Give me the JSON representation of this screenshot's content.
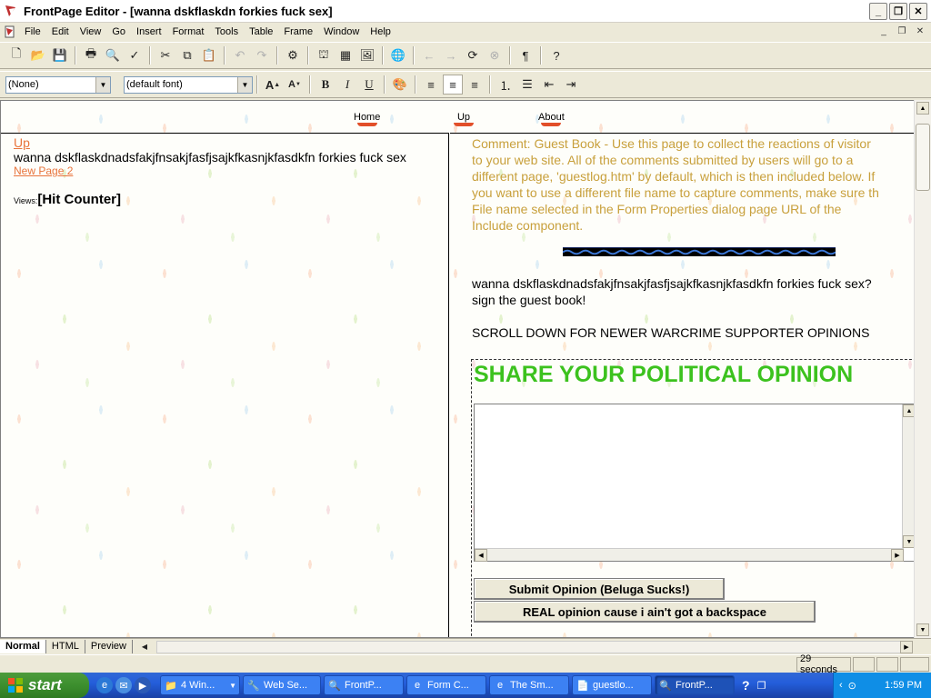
{
  "window": {
    "title": "FrontPage Editor - [wanna dskflaskdn forkies fuck sex]",
    "controls": {
      "minimize": "_",
      "maximize": "❐",
      "close": "✕"
    }
  },
  "menu": [
    "File",
    "Edit",
    "View",
    "Go",
    "Insert",
    "Format",
    "Tools",
    "Table",
    "Frame",
    "Window",
    "Help"
  ],
  "format_bar": {
    "style_value": "(None)",
    "font_value": "(default font)"
  },
  "nav": {
    "home": "Home",
    "up": "Up",
    "about": "About"
  },
  "left_frame": {
    "up_link": "Up",
    "headline": "wanna dskflaskdnadsfakjfnsakjfasfjsajkfkasnjkfasdkfn forkies fuck sex",
    "page_link": "New Page 2",
    "views_label": "Views:",
    "hit_counter": "[Hit Counter]"
  },
  "right_frame": {
    "comment_lines": [
      "Comment: Guest Book - Use this page to collect the reactions of visitor",
      "to your web site. All of the comments submitted by users will go to a",
      "different page, 'guestlog.htm' by default, which is then included below. If",
      "you want to use a different file name to capture comments, make sure th",
      "File name selected in the Form Properties dialog page URL of the",
      "Include component."
    ],
    "intro_line1": "wanna dskflaskdnadsfakjfnsakjfasfjsajkfkasnjkfasdkfn forkies fuck sex?",
    "intro_line2": "sign the guest book!",
    "scroll_note": "SCROLL DOWN FOR NEWER WARCRIME SUPPORTER OPINIONS",
    "form_heading": "SHARE YOUR POLITICAL OPINION",
    "textarea_value": "",
    "submit_button": "Submit Opinion (Beluga Sucks!)",
    "real_button": "REAL opinion cause i ain't got a backspace"
  },
  "view_tabs": [
    "Normal",
    "HTML",
    "Preview"
  ],
  "status": {
    "download_time": "29 seconds"
  },
  "taskbar": {
    "start": "start",
    "tasks": [
      {
        "label": "4 Win...",
        "icon": "folder-icon"
      },
      {
        "label": "Web Se...",
        "icon": "web-icon"
      },
      {
        "label": "FrontP...",
        "icon": "frontpage-icon"
      },
      {
        "label": "Form C...",
        "icon": "ie-icon"
      },
      {
        "label": "The Sm...",
        "icon": "ie-icon"
      },
      {
        "label": "guestlo...",
        "icon": "doc-icon"
      },
      {
        "label": "FrontP...",
        "icon": "frontpage-icon",
        "active": true
      }
    ],
    "clock": "1:59 PM"
  },
  "colors": {
    "link_orange": "#e8743c",
    "comment_gold": "#c8a03c",
    "heading_green": "#3cc21e",
    "nav_underline": "#e24f2a"
  }
}
